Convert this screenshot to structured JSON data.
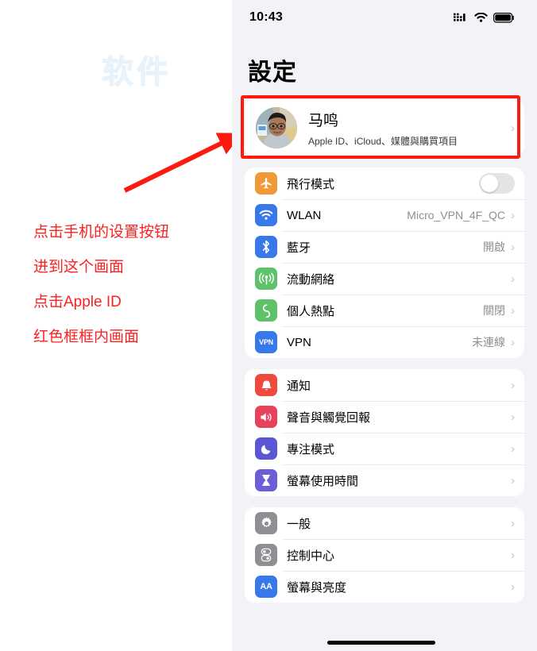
{
  "annotation": {
    "watermark": "软件",
    "arrow_icon": "red-arrow-icon",
    "lines": [
      "点击手机的设置按钮",
      "进到这个画面",
      "点击Apple ID",
      "红色框框内画面"
    ],
    "highlight_color": "#fc1b0e"
  },
  "phone": {
    "status_bar": {
      "time": "10:43",
      "signal_icon": "cellular-bars-icon",
      "wifi_icon": "wifi-icon",
      "battery_icon": "battery-full-icon"
    },
    "title": "設定",
    "account": {
      "avatar_icon": "user-avatar",
      "name": "马鸣",
      "subtitle": "Apple ID、iCloud、媒體與購買項目",
      "chevron_icon": "chevron-right-icon"
    },
    "groups": [
      {
        "name": "connectivity",
        "rows": [
          {
            "icon": "airplane-icon",
            "icon_color": "#f09a37",
            "label": "飛行模式",
            "value": "",
            "control": "toggle",
            "toggle_on": false
          },
          {
            "icon": "wifi-icon",
            "icon_color": "#3779ea",
            "label": "WLAN",
            "value": "Micro_VPN_4F_QC",
            "control": "chevron"
          },
          {
            "icon": "bluetooth-icon",
            "icon_color": "#3779ea",
            "label": "藍牙",
            "value": "開啟",
            "control": "chevron"
          },
          {
            "icon": "cellular-antenna-icon",
            "icon_color": "#5ec269",
            "label": "流動網絡",
            "value": "",
            "control": "chevron"
          },
          {
            "icon": "personal-hotspot-icon",
            "icon_color": "#5ec269",
            "label": "個人熱點",
            "value": "關閉",
            "control": "chevron"
          },
          {
            "icon": "vpn-icon",
            "icon_color": "#3779ea",
            "label": "VPN",
            "value": "未連線",
            "control": "chevron"
          }
        ]
      },
      {
        "name": "alerts",
        "rows": [
          {
            "icon": "bell-icon",
            "icon_color": "#f04a3e",
            "label": "通知",
            "value": "",
            "control": "chevron"
          },
          {
            "icon": "speaker-icon",
            "icon_color": "#e8415a",
            "label": "聲音與觸覺回報",
            "value": "",
            "control": "chevron"
          },
          {
            "icon": "moon-icon",
            "icon_color": "#5a56d6",
            "label": "專注模式",
            "value": "",
            "control": "chevron"
          },
          {
            "icon": "hourglass-icon",
            "icon_color": "#6b5ed8",
            "label": "螢幕使用時間",
            "value": "",
            "control": "chevron"
          }
        ]
      },
      {
        "name": "system",
        "rows": [
          {
            "icon": "gear-icon",
            "icon_color": "#8e8e93",
            "label": "一般",
            "value": "",
            "control": "chevron"
          },
          {
            "icon": "control-center-icon",
            "icon_color": "#8e8e93",
            "label": "控制中心",
            "value": "",
            "control": "chevron"
          },
          {
            "icon": "display-brightness-icon",
            "icon_color": "#3779ea",
            "label": "螢幕與亮度",
            "value": "",
            "control": "chevron"
          }
        ]
      }
    ],
    "home_indicator_icon": "home-indicator"
  }
}
